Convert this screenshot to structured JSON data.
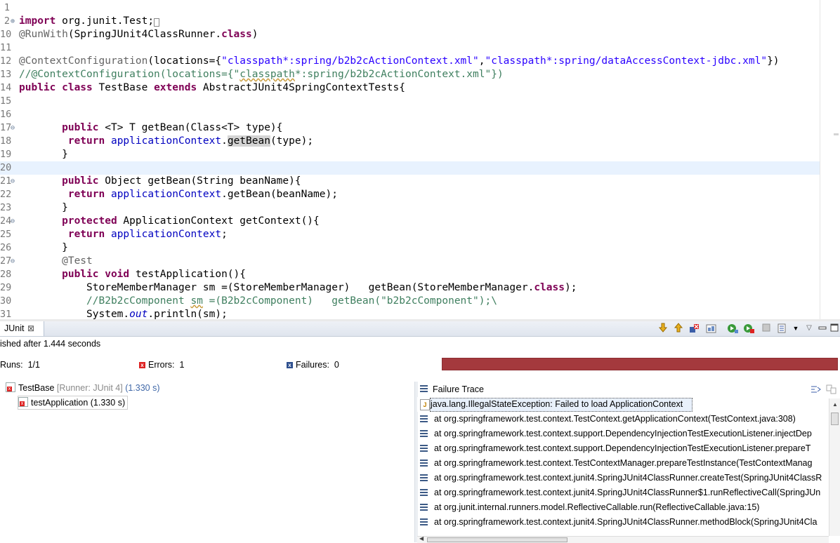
{
  "editor": {
    "lines": [
      {
        "num": "1",
        "fold": "",
        "html": ""
      },
      {
        "num": "2",
        "fold": "⊕",
        "html": "<span class=\"kw\">import</span> org.junit.Test;<span style=\"border:1px solid #888;font-size:9px;\">&nbsp;</span>"
      },
      {
        "num": "10",
        "fold": "",
        "html": "<span class=\"ann\">@RunWith</span>(SpringJUnit4ClassRunner.<span class=\"kw\">class</span>)"
      },
      {
        "num": "11",
        "fold": "",
        "html": ""
      },
      {
        "num": "12",
        "fold": "",
        "html": "<span class=\"ann\">@ContextConfiguration</span>(locations={<span class=\"str\">\"classpath*:spring/b2b2cActionContext.xml\"</span>,<span class=\"str\">\"classpath*:spring/dataAccessContext-jdbc.xml\"</span>})"
      },
      {
        "num": "13",
        "fold": "",
        "html": "<span class=\"cmt\">//@ContextConfiguration(locations={\"<span class=\"sq\">classpath</span>*:spring/b2b2cActionContext.xml\"})</span>"
      },
      {
        "num": "14",
        "fold": "",
        "html": "<span class=\"kw\">public class</span> TestBase <span class=\"kw\">extends</span> AbstractJUnit4SpringContextTests{"
      },
      {
        "num": "15",
        "fold": "",
        "html": ""
      },
      {
        "num": "16",
        "fold": "",
        "html": ""
      },
      {
        "num": "17",
        "fold": "⊖",
        "html": "       <span class=\"kw\">public</span> &lt;T&gt; T getBean(Class&lt;T&gt; type){"
      },
      {
        "num": "18",
        "fold": "",
        "html": "        <span class=\"kw\">return</span> <span class=\"fld\">applicationContext</span>.<span class=\"occ\">getBean</span>(type);"
      },
      {
        "num": "19",
        "fold": "",
        "html": "       }"
      },
      {
        "num": "20",
        "fold": "",
        "html": "",
        "highlight": true
      },
      {
        "num": "21",
        "fold": "⊖",
        "html": "       <span class=\"kw\">public</span> Object getBean(String beanName){"
      },
      {
        "num": "22",
        "fold": "",
        "html": "        <span class=\"kw\">return</span> <span class=\"fld\">applicationContext</span>.getBean(beanName);"
      },
      {
        "num": "23",
        "fold": "",
        "html": "       }"
      },
      {
        "num": "24",
        "fold": "⊖",
        "html": "       <span class=\"kw\">protected</span> ApplicationContext getContext(){"
      },
      {
        "num": "25",
        "fold": "",
        "html": "        <span class=\"kw\">return</span> <span class=\"fld\">applicationContext</span>;"
      },
      {
        "num": "26",
        "fold": "",
        "html": "       }"
      },
      {
        "num": "27",
        "fold": "⊖",
        "html": "       <span class=\"ann\">@Test</span>"
      },
      {
        "num": "28",
        "fold": "",
        "html": "       <span class=\"kw\">public void</span> testApplication(){"
      },
      {
        "num": "29",
        "fold": "",
        "html": "           StoreMemberManager sm =(StoreMemberManager)   getBean(StoreMemberManager.<span class=\"kw\">class</span>);"
      },
      {
        "num": "30",
        "fold": "",
        "html": "           <span class=\"cmt\">//B2b2cComponent <span class=\"sq\">sm</span> =(B2b2cComponent)   getBean(\"b2b2cComponent\");\\</span>"
      },
      {
        "num": "31",
        "fold": "",
        "html": "           System.<span class=\"fld ital\">out</span>.println(sm);"
      }
    ]
  },
  "junit": {
    "tab_label": "JUnit",
    "tab_close": "⊠",
    "status": "ished after 1.444 seconds",
    "runs_label": "Runs:",
    "runs_value": "1/1",
    "errors_label": "Errors:",
    "errors_value": "1",
    "failures_label": "Failures:",
    "failures_value": "0",
    "progress_state": "failed",
    "progress_color": "#a4393d",
    "tree": {
      "suite_name": "TestBase",
      "suite_runner": "[Runner: JUnit 4]",
      "suite_time": "(1.330 s)",
      "test_name": "testApplication (1.330 s)"
    },
    "trace": {
      "title": "Failure Trace",
      "lines": [
        "java.lang.IllegalStateException: Failed to load ApplicationContext",
        "at org.springframework.test.context.TestContext.getApplicationContext(TestContext.java:308)",
        "at org.springframework.test.context.support.DependencyInjectionTestExecutionListener.injectDep",
        "at org.springframework.test.context.support.DependencyInjectionTestExecutionListener.prepareT",
        "at org.springframework.test.context.TestContextManager.prepareTestInstance(TestContextManag",
        "at org.springframework.test.context.junit4.SpringJUnit4ClassRunner.createTest(SpringJUnit4ClassR",
        "at org.springframework.test.context.junit4.SpringJUnit4ClassRunner$1.runReflectiveCall(SpringJUn",
        "at org.junit.internal.runners.model.ReflectiveCallable.run(ReflectiveCallable.java:15)",
        "at org.springframework.test.context.junit4.SpringJUnit4ClassRunner.methodBlock(SpringJUnit4Cla"
      ]
    }
  },
  "icons": [
    "next-failure-icon",
    "previous-failure-icon",
    "show-failures-only-icon",
    "scroll-lock-icon",
    "rerun-icon",
    "rerun-failed-first-icon",
    "stop-icon",
    "history-icon",
    "view-menu-icon",
    "minimize-icon",
    "maximize-icon",
    "filter-stack-icon",
    "compare-icon"
  ]
}
